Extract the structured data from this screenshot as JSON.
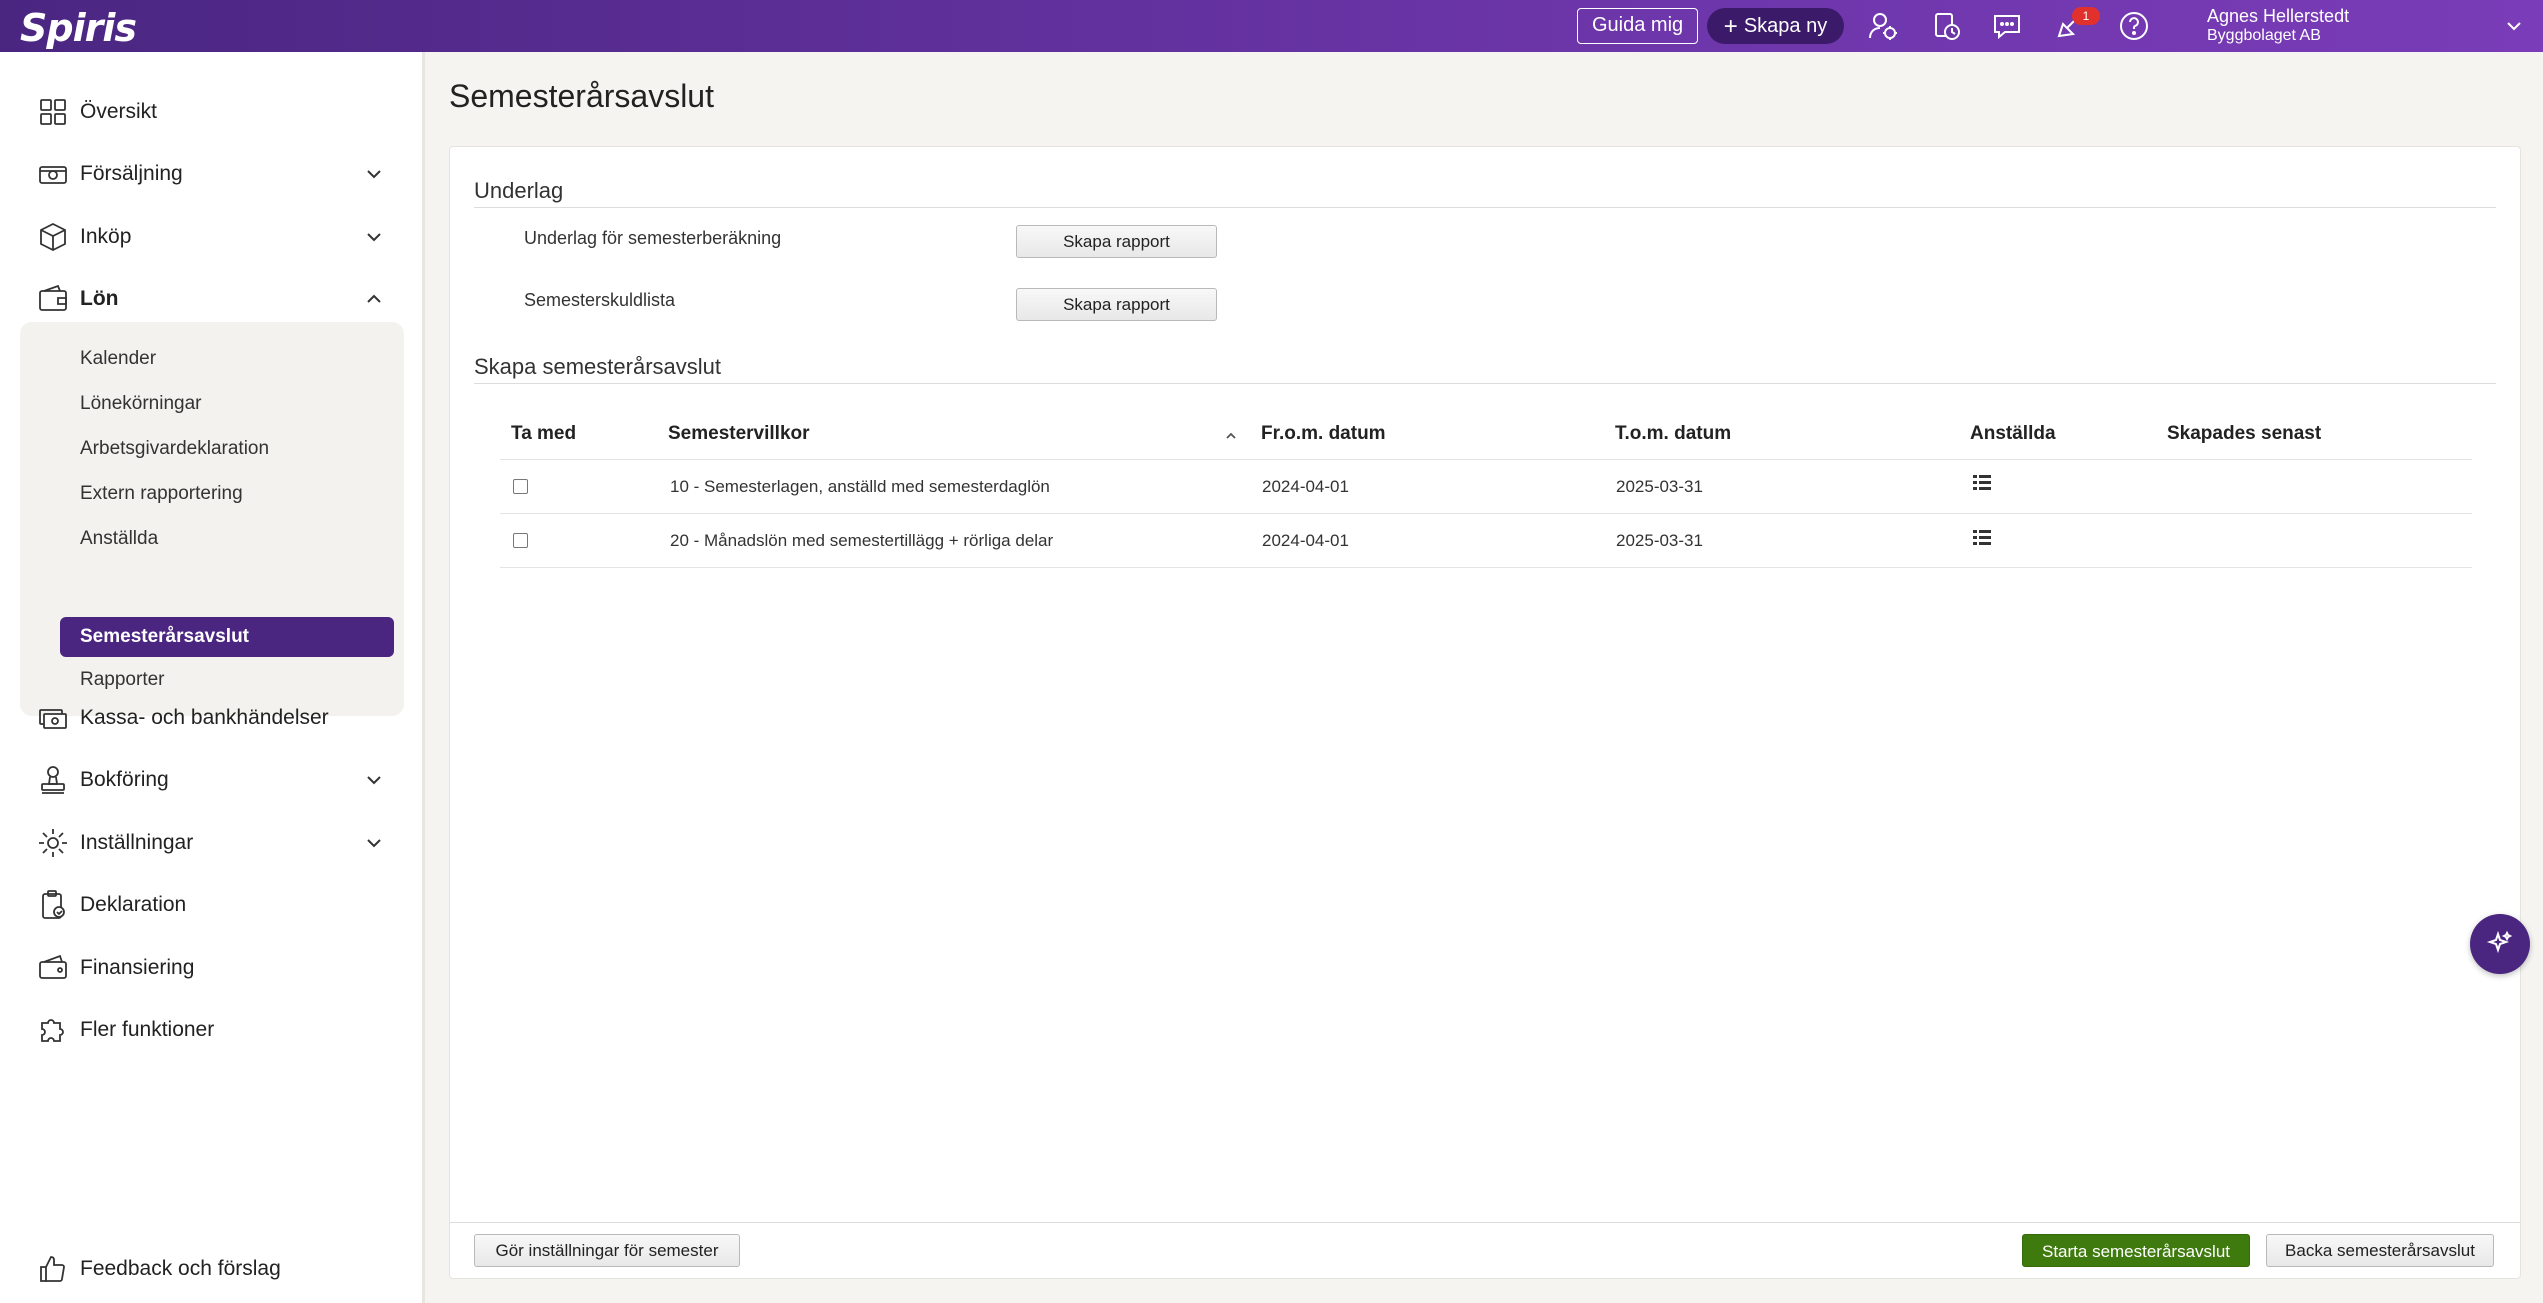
{
  "topbar": {
    "logo": "Spiris",
    "guide_button": "Guida mig",
    "create_new_button": "Skapa ny",
    "notification_count": "1",
    "user_name": "Agnes Hellerstedt",
    "company": "Byggbolaget AB",
    "brand_color": "#4a2681"
  },
  "sidebar": {
    "items": [
      {
        "label": "Översikt",
        "icon": "grid-icon"
      },
      {
        "label": "Försäljning",
        "icon": "cash-register-icon"
      },
      {
        "label": "Inköp",
        "icon": "box-icon"
      },
      {
        "label": "Lön",
        "icon": "wallet-icon"
      },
      {
        "label": "Kassa- och bankhändelser",
        "icon": "money-icon"
      },
      {
        "label": "Bokföring",
        "icon": "stamp-icon"
      },
      {
        "label": "Inställningar",
        "icon": "gear-icon"
      },
      {
        "label": "Deklaration",
        "icon": "clipboard-icon"
      },
      {
        "label": "Finansiering",
        "icon": "finance-icon"
      },
      {
        "label": "Fler funktioner",
        "icon": "puzzle-icon"
      }
    ],
    "lon_sub": [
      "Kalender",
      "Lönekörningar",
      "Arbetsgivardeklaration",
      "Extern rapportering",
      "Anställda",
      "Semesterårsavslut",
      "Rapporter"
    ],
    "feedback": "Feedback och förslag"
  },
  "main": {
    "title": "Semesterårsavslut",
    "underlag": {
      "title": "Underlag",
      "rows": [
        {
          "label": "Underlag för semesterberäkning",
          "button": "Skapa rapport"
        },
        {
          "label": "Semesterskuldlista",
          "button": "Skapa rapport"
        }
      ]
    },
    "create": {
      "title": "Skapa semesterårsavslut",
      "columns": [
        "Ta med",
        "Semestervillkor",
        "Fr.o.m. datum",
        "T.o.m. datum",
        "Anställda",
        "Skapades senast"
      ],
      "rows": [
        {
          "villkor": "10 - Semesterlagen, anställd med semesterdaglön",
          "from": "2024-04-01",
          "to": "2025-03-31",
          "created": ""
        },
        {
          "villkor": "20 - Månadslön med semestertillägg + rörliga delar",
          "from": "2024-04-01",
          "to": "2025-03-31",
          "created": ""
        }
      ]
    },
    "footer": {
      "settings_button": "Gör inställningar för semester",
      "start_button": "Starta semesterårsavslut",
      "undo_button": "Backa semesterårsavslut"
    }
  }
}
